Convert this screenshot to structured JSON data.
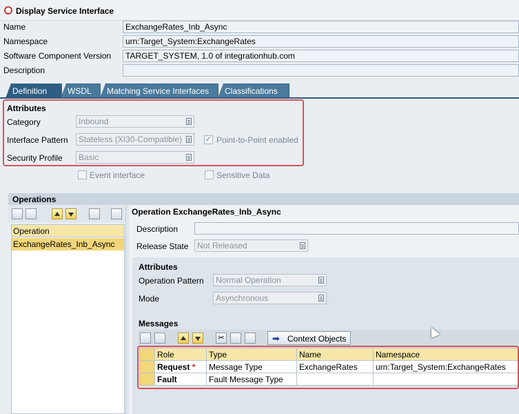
{
  "window": {
    "title": "Display Service Interface"
  },
  "header_fields": [
    {
      "label": "Name",
      "value": "ExchangeRates_Inb_Async"
    },
    {
      "label": "Namespace",
      "value": "urn:Target_System:ExchangeRates"
    },
    {
      "label": "Software Component Version",
      "value": "TARGET_SYSTEM, 1.0 of integrationhub.com"
    },
    {
      "label": "Description",
      "value": ""
    }
  ],
  "tabs": [
    "Definition",
    "WSDL",
    "Matching Service Interfaces",
    "Classifications"
  ],
  "attributes": {
    "heading": "Attributes",
    "category_label": "Category",
    "category_value": "Inbound",
    "pattern_label": "Interface Pattern",
    "pattern_value": "Stateless (XI30-Compatible)",
    "p2p_label": "Point-to-Point enabled",
    "security_label": "Security Profile",
    "security_value": "Basic",
    "event_label": "Event interface",
    "sensitive_label": "Sensitive Data"
  },
  "operations": {
    "heading": "Operations",
    "column_header": "Operation",
    "items": [
      "ExchangeRates_Inb_Async"
    ]
  },
  "operation_detail": {
    "title": "Operation ExchangeRates_Inb_Async",
    "description_label": "Description",
    "release_label": "Release State",
    "release_value": "Not Released",
    "attr_heading": "Attributes",
    "op_pattern_label": "Operation Pattern",
    "op_pattern_value": "Normal Operation",
    "mode_label": "Mode",
    "mode_value": "Asynchronous"
  },
  "messages": {
    "heading": "Messages",
    "context_button": "Context Objects",
    "columns": [
      "Role",
      "Type",
      "Name",
      "Namespace"
    ],
    "rows": [
      {
        "role": "Request",
        "required": "*",
        "type": "Message Type",
        "name": "ExchangeRates",
        "namespace": "urn:Target_System:ExchangeRates"
      },
      {
        "role": "Fault",
        "required": "",
        "type": "Fault Message Type",
        "name": "",
        "namespace": ""
      }
    ]
  },
  "colors": {
    "accent_tab": "#2e5f82",
    "highlight_red": "#d9535b",
    "selection_yellow": "#f2d67a"
  }
}
